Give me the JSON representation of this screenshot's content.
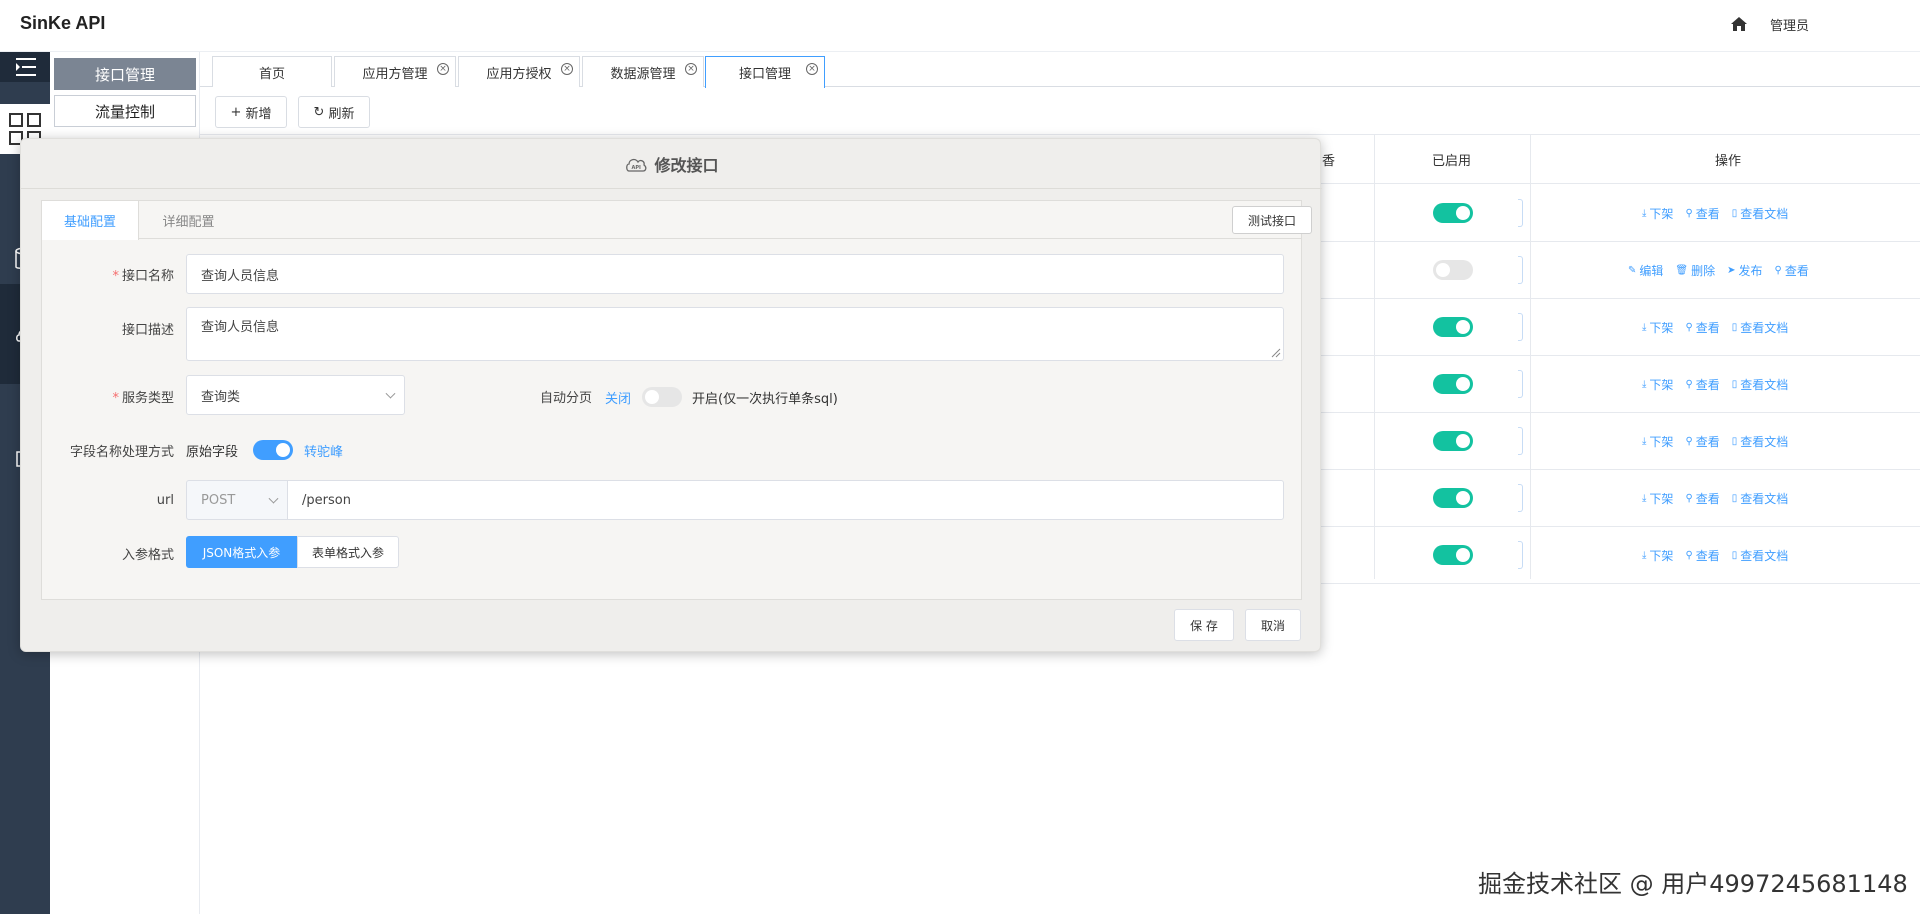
{
  "app": {
    "title": "SinKe API",
    "user": "管理员"
  },
  "submenu": {
    "items": [
      "接口管理",
      "流量控制"
    ]
  },
  "tabs": [
    {
      "label": "首页"
    },
    {
      "label": "应用方管理"
    },
    {
      "label": "应用方授权"
    },
    {
      "label": "数据源管理"
    },
    {
      "label": "接口管理"
    }
  ],
  "toolbar": {
    "add": "新增",
    "refresh": "刷新"
  },
  "table": {
    "headers": {
      "partial": "香",
      "enabled": "已启用",
      "actions": "操作"
    },
    "rows": [
      {
        "enabled": true,
        "actions": [
          "下架",
          "查看",
          "查看文档"
        ]
      },
      {
        "enabled": false,
        "actions": [
          "编辑",
          "删除",
          "发布",
          "查看"
        ]
      },
      {
        "enabled": true,
        "actions": [
          "下架",
          "查看",
          "查看文档"
        ]
      },
      {
        "enabled": true,
        "actions": [
          "下架",
          "查看",
          "查看文档"
        ]
      },
      {
        "enabled": true,
        "actions": [
          "下架",
          "查看",
          "查看文档"
        ]
      },
      {
        "enabled": true,
        "actions": [
          "下架",
          "查看",
          "查看文档"
        ]
      },
      {
        "enabled": true,
        "actions": [
          "下架",
          "查看",
          "查看文档"
        ]
      }
    ]
  },
  "dialog": {
    "title": "修改接口",
    "tabs": [
      "基础配置",
      "详细配置"
    ],
    "test_button": "测试接口",
    "fields": {
      "name_label": "接口名称",
      "name_value": "查询人员信息",
      "desc_label": "接口描述",
      "desc_value": "查询人员信息",
      "service_label": "服务类型",
      "service_value": "查询类",
      "paging_label": "自动分页",
      "paging_off": "关闭",
      "paging_on": "开启(仅一次执行单条sql)",
      "field_label": "字段名称处理方式",
      "field_left": "原始字段",
      "field_right": "转驼峰",
      "url_label": "url",
      "method_value": "POST",
      "url_value": "/person",
      "param_label": "入参格式",
      "param_json": "JSON格式入参",
      "param_form": "表单格式入参"
    },
    "save": "保 存",
    "cancel": "取消"
  },
  "watermark": "掘金技术社区 @ 用户4997245681148",
  "colors": {
    "primary": "#409eff",
    "switch_on": "#13c2a0",
    "sidebar": "#2f3d4f"
  }
}
